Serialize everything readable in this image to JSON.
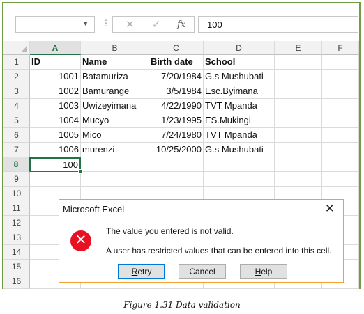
{
  "formula_bar": {
    "name_box": "",
    "cancel_icon": "✕",
    "enter_icon": "✓",
    "fx_label": "fx",
    "value": "100"
  },
  "columns": [
    "A",
    "B",
    "C",
    "D",
    "E",
    "F"
  ],
  "rows": [
    "1",
    "2",
    "3",
    "4",
    "5",
    "6",
    "7",
    "8",
    "9",
    "10",
    "11",
    "12",
    "13",
    "14",
    "15",
    "16"
  ],
  "table": {
    "headers": [
      "ID",
      "Name",
      "Birth date",
      "School"
    ],
    "records": [
      [
        "1001",
        "Batamuriza",
        "7/20/1984",
        "G.s Mushubati"
      ],
      [
        "1002",
        "Bamurange",
        "3/5/1984",
        "Esc.Byimana"
      ],
      [
        "1003",
        "Uwizeyimana",
        "4/22/1990",
        "TVT Mpanda"
      ],
      [
        "1004",
        "Mucyo",
        "1/23/1995",
        "ES.Mukingi"
      ],
      [
        "1005",
        "Mico",
        "7/24/1980",
        "TVT Mpanda"
      ],
      [
        "1006",
        "murenzi",
        "10/25/2000",
        "G.s Mushubati"
      ]
    ],
    "active_cell_value": "100"
  },
  "dialog": {
    "title": "Microsoft Excel",
    "close_icon": "✕",
    "error_icon": "✕",
    "message_1": "The value you entered is not valid.",
    "message_2": "A user has restricted values that can be entered into this cell.",
    "retry": {
      "mnemonic": "R",
      "rest": "etry"
    },
    "cancel": "Cancel",
    "help": {
      "mnemonic": "H",
      "rest": "elp"
    },
    "accent_color": "#f0a030",
    "error_color": "#e81123"
  },
  "caption": "Figure 1.31 Data validation"
}
